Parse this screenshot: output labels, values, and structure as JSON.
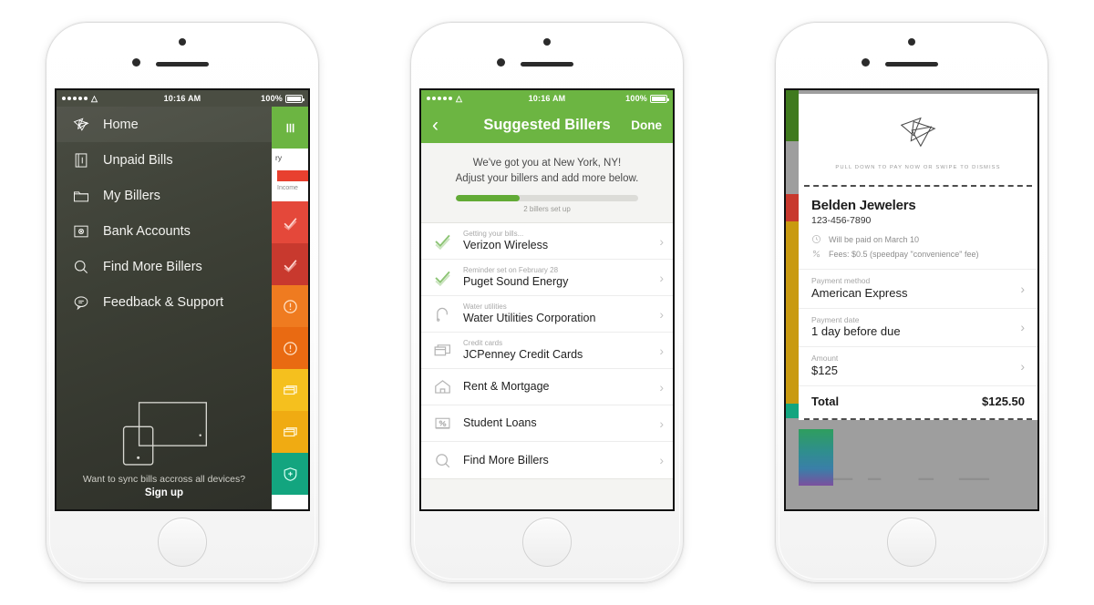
{
  "status_bar": {
    "carrier_dots": 5,
    "wifi_icon": "wifi-icon",
    "time": "10:16 AM",
    "battery_percent": "100%"
  },
  "phone1": {
    "name": "sidebar-menu-screen",
    "menu_items": [
      {
        "label": "Home",
        "icon": "origami-star-icon",
        "active": true
      },
      {
        "label": "Unpaid Bills",
        "icon": "document-icon",
        "active": false
      },
      {
        "label": "My Billers",
        "icon": "folder-icon",
        "active": false
      },
      {
        "label": "Bank Accounts",
        "icon": "vault-icon",
        "active": false
      },
      {
        "label": "Find More Billers",
        "icon": "search-icon",
        "active": false
      },
      {
        "label": "Feedback & Support",
        "icon": "speech-bubble-icon",
        "active": false
      }
    ],
    "promo": {
      "illustration": "devices-sync-icon",
      "text": "Want to sync bills accross all devices?",
      "link": "Sign up"
    },
    "strip": {
      "menu_icon": "hamburger-icon",
      "peek_card": {
        "title": "ry",
        "sub": "Income",
        "bar_color": "#e8402f"
      },
      "rows": [
        {
          "icon": "check-icon",
          "color": "#e4483a"
        },
        {
          "icon": "check-icon",
          "color": "#c8392e"
        },
        {
          "icon": "alert-icon",
          "color": "#ef7b20"
        },
        {
          "icon": "alert-icon",
          "color": "#e96a12"
        },
        {
          "icon": "wallet-icon",
          "color": "#f5c01e"
        },
        {
          "icon": "wallet-icon",
          "color": "#f0ab12"
        },
        {
          "icon": "shield-plus-icon",
          "color": "#13a57f"
        },
        {
          "icon": "calendar-icon",
          "color": "#ffffff"
        },
        {
          "icon": "wallet-icon",
          "color": "#18b98d"
        }
      ]
    }
  },
  "phone2": {
    "name": "suggested-billers-screen",
    "nav": {
      "back_icon": "chevron-left-icon",
      "title": "Suggested Billers",
      "done_label": "Done"
    },
    "banner": {
      "line1": "We've got you at New York, NY!",
      "line2": "Adjust your billers and add more below.",
      "progress_percent": 35,
      "progress_label": "2 billers set up"
    },
    "rows": [
      {
        "sub": "Getting your bills...",
        "name": "Verizon Wireless",
        "icon": "check-icon",
        "chevron": "chevron-right-icon"
      },
      {
        "sub": "Reminder set on February 28",
        "name": "Puget Sound Energy",
        "icon": "check-icon",
        "chevron": "chevron-right-icon"
      },
      {
        "sub": "Water utilities",
        "name": "Water Utilities Corporation",
        "icon": "faucet-icon",
        "chevron": "chevron-right-icon"
      },
      {
        "sub": "Credit cards",
        "name": "JCPenney Credit Cards",
        "icon": "credit-cards-icon",
        "chevron": "chevron-right-icon"
      },
      {
        "sub": "",
        "name": "Rent & Mortgage",
        "icon": "house-icon",
        "chevron": "chevron-right-icon"
      },
      {
        "sub": "",
        "name": "Student Loans",
        "icon": "percent-document-icon",
        "chevron": "chevron-right-icon"
      },
      {
        "sub": "",
        "name": "Find More Billers",
        "icon": "search-icon",
        "chevron": "chevron-right-icon"
      }
    ]
  },
  "phone3": {
    "name": "bill-receipt-screen",
    "card": {
      "logo_icon": "origami-star-icon",
      "pull_hint": "PULL DOWN TO PAY NOW OR SWIPE TO DISMISS",
      "biller": "Belden Jewelers",
      "phone": "123-456-7890",
      "meta": [
        {
          "icon": "clock-icon",
          "text": "Will be paid on March 10"
        },
        {
          "icon": "percent-icon",
          "text": "Fees: $0.5 (speedpay \"convenience\" fee)"
        }
      ],
      "fields": [
        {
          "label": "Payment method",
          "value": "American Express",
          "chevron": "chevron-right-icon"
        },
        {
          "label": "Payment date",
          "value": "1 day before due",
          "chevron": "chevron-right-icon"
        },
        {
          "label": "Amount",
          "value": "$125",
          "chevron": "chevron-right-icon"
        }
      ],
      "total_label": "Total",
      "total_value": "$125.50"
    },
    "strip_colors": [
      "#3f7a1e",
      "#9e9e9e",
      "#c8392e",
      "#c99a10",
      "#13a57f"
    ],
    "bottom_strip_colors": [
      "#2f9e5e",
      "#2f8e8e",
      "#3a7fa8",
      "#7b4f9e"
    ]
  }
}
